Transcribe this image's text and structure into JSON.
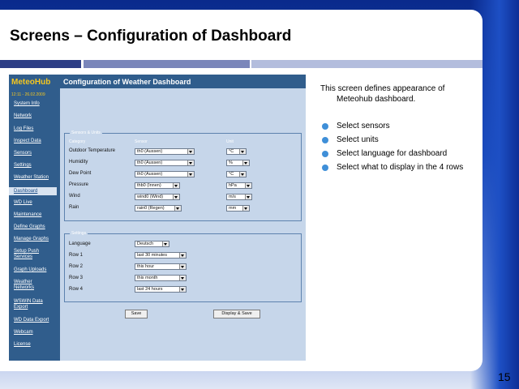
{
  "slide": {
    "title": "Screens – Configuration of Dashboard",
    "page_number": "15",
    "description_line1": "This screen defines appearance of",
    "description_line2": "Meteohub dashboard.",
    "bullets": [
      "Select sensors",
      "Select units",
      "Select language for dashboard",
      "Select what to display in the 4 rows"
    ]
  },
  "app": {
    "logo": "MeteoHub",
    "date": "12:11 - 26.02.2009",
    "title": "Configuration of Weather Dashboard",
    "nav": [
      {
        "label": "System Info"
      },
      {
        "label": "Network"
      },
      {
        "label": "Log Files"
      },
      {
        "label": "Inspect Data"
      },
      {
        "label": "Sensors"
      },
      {
        "label": "Settings"
      },
      {
        "label": "Weather Station"
      },
      {
        "label": "Dashboard",
        "active": true
      },
      {
        "label": "WD Live"
      },
      {
        "label": "Maintenance"
      },
      {
        "label": "Define Graphs"
      },
      {
        "label": "Manage Graphs"
      },
      {
        "label": "Setup Push Services"
      },
      {
        "label": "Graph Uploads"
      },
      {
        "label": "Weather Networks"
      },
      {
        "label": "WSWIN Data Export"
      },
      {
        "label": "WD Data Export"
      },
      {
        "label": "Webcam"
      },
      {
        "label": "License"
      }
    ],
    "sensors": {
      "legend": "Sensors & Units",
      "headers": {
        "category": "Category",
        "sensor": "Sensor",
        "unit": "Unit"
      },
      "rows": [
        {
          "category": "Outdoor Temperature",
          "sensor": "th0 (Aussen)",
          "unit": "°C"
        },
        {
          "category": "Humidity",
          "sensor": "th0 (Aussen)",
          "unit": "%"
        },
        {
          "category": "Dew Point",
          "sensor": "th0 (Aussen)",
          "unit": "°C"
        },
        {
          "category": "Pressure",
          "sensor": "thb0 (Innen)",
          "unit": "hPa"
        },
        {
          "category": "Wind",
          "sensor": "wind0 (Wind)",
          "unit": "m/s"
        },
        {
          "category": "Rain",
          "sensor": "rain0 (Regen)",
          "unit": "mm"
        }
      ]
    },
    "settings": {
      "legend": "Settings",
      "rows": [
        {
          "label": "Language",
          "value": "Deutsch"
        },
        {
          "label": "Row 1",
          "value": "last 30 minutes"
        },
        {
          "label": "Row 2",
          "value": "this hour"
        },
        {
          "label": "Row 3",
          "value": "this month"
        },
        {
          "label": "Row 4",
          "value": "last 24 hours"
        }
      ]
    },
    "buttons": {
      "save": "Save",
      "display_save": "Display & Save"
    }
  }
}
